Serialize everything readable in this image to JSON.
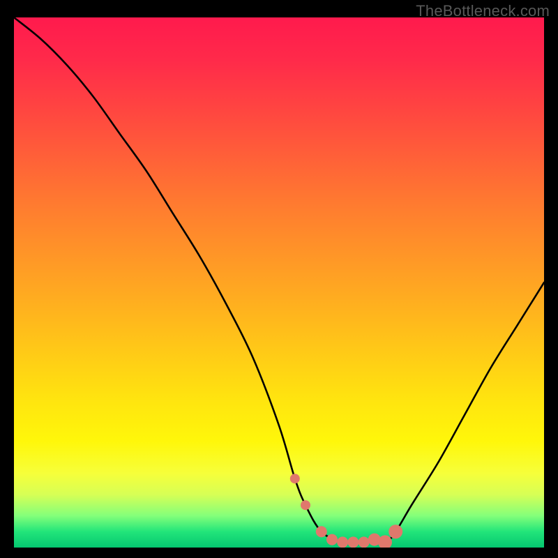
{
  "watermark": "TheBottleneck.com",
  "chart_data": {
    "type": "line",
    "title": "",
    "xlabel": "",
    "ylabel": "",
    "xlim": [
      0,
      100
    ],
    "ylim": [
      0,
      100
    ],
    "grid": false,
    "series": [
      {
        "name": "bottleneck-curve",
        "x": [
          0,
          5,
          10,
          15,
          20,
          25,
          30,
          35,
          40,
          45,
          50,
          53,
          55,
          58,
          62,
          66,
          70,
          72,
          75,
          80,
          85,
          90,
          95,
          100
        ],
        "values": [
          100,
          96,
          91,
          85,
          78,
          71,
          63,
          55,
          46,
          36,
          23,
          13,
          8,
          3,
          1,
          1,
          1,
          3,
          8,
          16,
          25,
          34,
          42,
          50
        ]
      }
    ],
    "markers": {
      "name": "highlight-points",
      "color": "#e0786c",
      "x": [
        53,
        55,
        58,
        60,
        62,
        64,
        66,
        68,
        70,
        72
      ],
      "y": [
        13,
        8,
        3,
        1.5,
        1,
        1,
        1,
        1.5,
        1,
        3
      ],
      "sizes": [
        7,
        7,
        8,
        8,
        8,
        8,
        8,
        9,
        10,
        10
      ]
    },
    "background_gradient": {
      "top": "#ff1a4d",
      "middle": "#ffe40f",
      "bottom": "#05c770"
    }
  }
}
